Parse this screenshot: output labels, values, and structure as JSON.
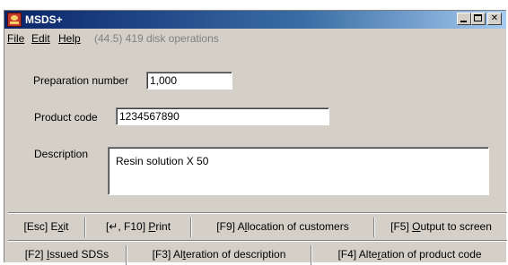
{
  "window": {
    "title": "MSDS+"
  },
  "menu": {
    "file": {
      "label": "File",
      "accel": "F"
    },
    "edit": {
      "label": "Edit",
      "accel": "E"
    },
    "help": {
      "label": "Help",
      "accel": "H"
    },
    "status": "(44.5) 419 disk operations"
  },
  "form": {
    "prep_label": "Preparation number",
    "prep_value": "1,000",
    "code_label": "Product code",
    "code_value": "1234567890",
    "desc_label": "Description",
    "desc_value": "Resin solution X 50"
  },
  "buttons_row1": [
    {
      "pre": "[Esc] E",
      "ul": "x",
      "post": "it"
    },
    {
      "pre": "[↵, F10] ",
      "ul": "P",
      "post": "rint"
    },
    {
      "pre": "[F9] A",
      "ul": "l",
      "post": "location of customers"
    },
    {
      "pre": "[F5] ",
      "ul": "O",
      "post": "utput to screen"
    }
  ],
  "buttons_row2": [
    {
      "pre": "[F2] ",
      "ul": "I",
      "post": "ssued SDSs"
    },
    {
      "pre": "[F3] Al",
      "ul": "t",
      "post": "eration of description"
    },
    {
      "pre": "[F4] Alte",
      "ul": "r",
      "post": "ation of product code"
    }
  ],
  "colors": {
    "window_bg": "#d4d0c8",
    "title_active": "#0a246a",
    "status_gray": "#808080"
  }
}
